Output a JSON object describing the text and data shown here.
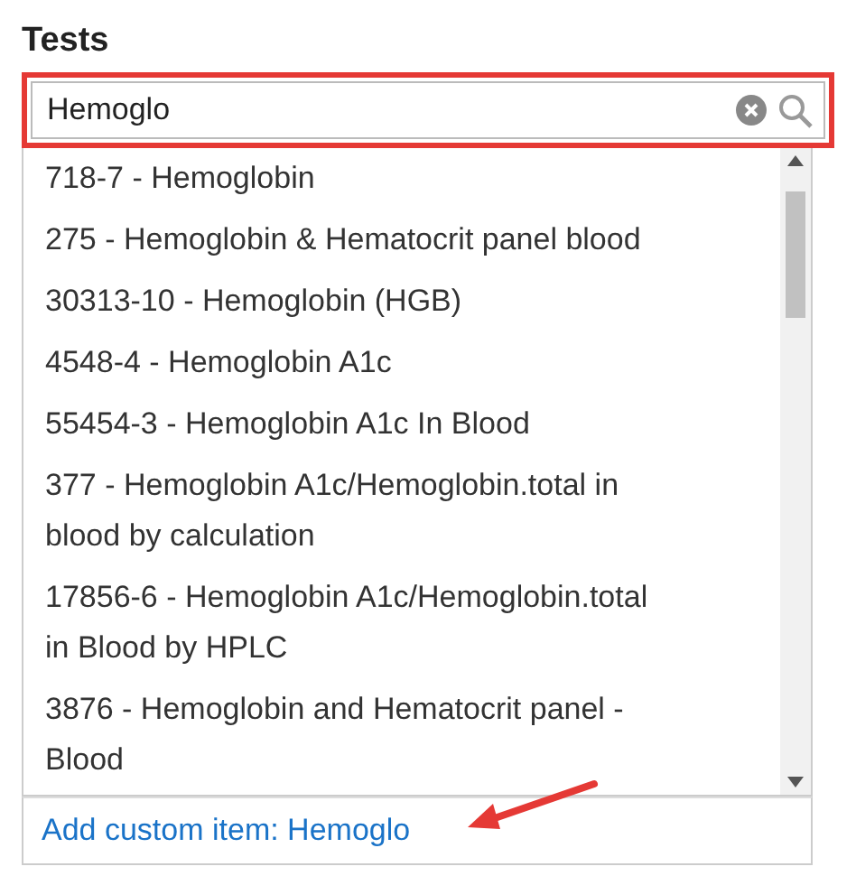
{
  "label": "Tests",
  "search": {
    "value": "Hemoglo"
  },
  "results": [
    {
      "text": "718-7 - Hemoglobin"
    },
    {
      "text": "275 - Hemoglobin & Hematocrit panel blood"
    },
    {
      "text": "30313-10 - Hemoglobin (HGB)"
    },
    {
      "text": "4548-4 - Hemoglobin A1c"
    },
    {
      "text": "55454-3 - Hemoglobin A1c In Blood"
    },
    {
      "text": "377 - Hemoglobin A1c/Hemoglobin.total in blood by calculation"
    },
    {
      "text": "17856-6 - Hemoglobin A1c/Hemoglobin.total in Blood by HPLC"
    },
    {
      "text": "3876 - Hemoglobin and Hematocrit panel - Blood"
    }
  ],
  "footer_link": {
    "text": "Add custom item: Hemoglo"
  },
  "annotation": {
    "highlight_frame": true,
    "pointer_arrow": true
  }
}
